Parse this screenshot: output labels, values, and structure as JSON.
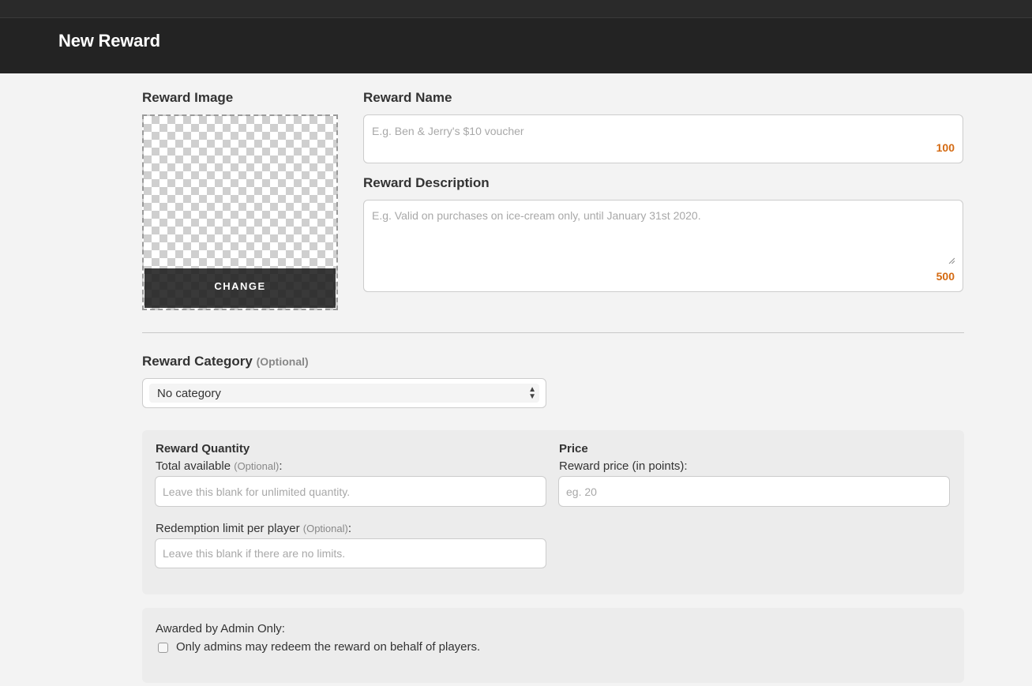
{
  "header": {
    "title": "New Reward"
  },
  "image": {
    "label": "Reward Image",
    "change_label": "CHANGE"
  },
  "name": {
    "label": "Reward Name",
    "placeholder": "E.g. Ben & Jerry's $10 voucher",
    "counter": "100"
  },
  "description": {
    "label": "Reward Description",
    "placeholder": "E.g. Valid on purchases on ice-cream only, until January 31st 2020.",
    "counter": "500"
  },
  "category": {
    "label": "Reward Category",
    "optional": "(Optional)",
    "selected": "No category"
  },
  "quantity": {
    "title": "Reward Quantity",
    "total_label": "Total available",
    "total_optional": "(Optional)",
    "total_colon": ":",
    "total_placeholder": "Leave this blank for unlimited quantity.",
    "limit_label": "Redemption limit per player",
    "limit_optional": "(Optional)",
    "limit_colon": ":",
    "limit_placeholder": "Leave this blank if there are no limits."
  },
  "price": {
    "title": "Price",
    "label": "Reward price (in points):",
    "placeholder": "eg. 20"
  },
  "admin": {
    "label": "Awarded by Admin Only:",
    "checkbox_label": "Only admins may redeem the reward on behalf of players.",
    "checked": false
  },
  "colors": {
    "accent_counter": "#d46a12",
    "header_bg": "#232323"
  }
}
